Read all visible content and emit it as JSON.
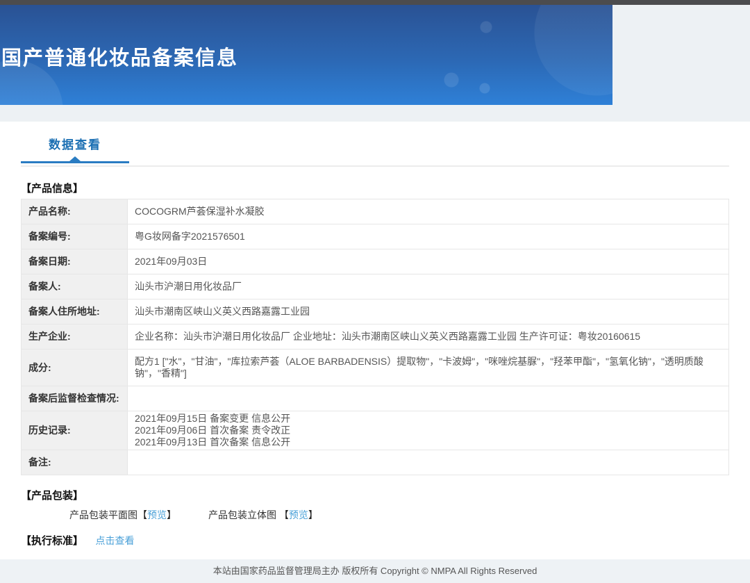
{
  "header": {
    "title": "国产普通化妆品备案信息"
  },
  "tabs": [
    {
      "label": "数据查看",
      "active": true
    }
  ],
  "tokens": {
    "bracket_open": "【",
    "bracket_close": "】"
  },
  "sections": {
    "product_info": {
      "heading": "【产品信息】",
      "rows": [
        {
          "label": "产品名称:",
          "value": "COCOGRM芦荟保湿补水凝胶"
        },
        {
          "label": "备案编号:",
          "value": "粤G妆网备字2021576501"
        },
        {
          "label": "备案日期:",
          "value": "2021年09月03日"
        },
        {
          "label": "备案人:",
          "value": "汕头市沪潮日用化妆品厂"
        },
        {
          "label": "备案人住所地址:",
          "value": "汕头市潮南区峡山义英义西路嘉露工业园"
        },
        {
          "label": "生产企业:",
          "value": "企业名称：汕头市沪潮日用化妆品厂 企业地址：汕头市潮南区峡山义英义西路嘉露工业园 生产许可证：粤妆20160615"
        },
        {
          "label": "成分:",
          "value": "配方1 [\"水\"，\"甘油\"，\"库拉索芦荟（ALOE BARBADENSIS）提取物\"，\"卡波姆\"，\"咪唑烷基脲\"，\"羟苯甲酯\"，\"氢氧化钠\"，\"透明质酸钠\"，\"香精\"]"
        },
        {
          "label": "备案后监督检查情况:",
          "value": ""
        },
        {
          "label": "历史记录:",
          "value": [
            "2021年09月15日 备案变更 信息公开",
            "2021年09月06日 首次备案 责令改正",
            "2021年09月13日 首次备案 信息公开"
          ]
        },
        {
          "label": "备注:",
          "value": ""
        }
      ]
    },
    "packaging": {
      "heading": "【产品包装】",
      "items": [
        {
          "label": "产品包装平面图",
          "link_text": "预览"
        },
        {
          "label": "产品包装立体图 ",
          "link_text": "预览"
        }
      ]
    },
    "standard": {
      "heading": "【执行标准】",
      "link_text": "点击查看"
    }
  },
  "footer": {
    "text": "本站由国家药品监督管理局主办 版权所有 Copyright © NMPA All Rights Reserved"
  },
  "colors": {
    "accent_blue": "#1b6fb3",
    "tab_underline_blue": "#2a7cc2",
    "link_blue": "#4aa0d8",
    "banner_gradient_top": "#2a5294",
    "banner_gradient_bottom": "#2e80d7",
    "top_strip": "#4c4c4e",
    "band_gray": "#edf1f4",
    "table_outer_border": "#c5d3dc",
    "table_label_bg": "#f0f0f0"
  }
}
